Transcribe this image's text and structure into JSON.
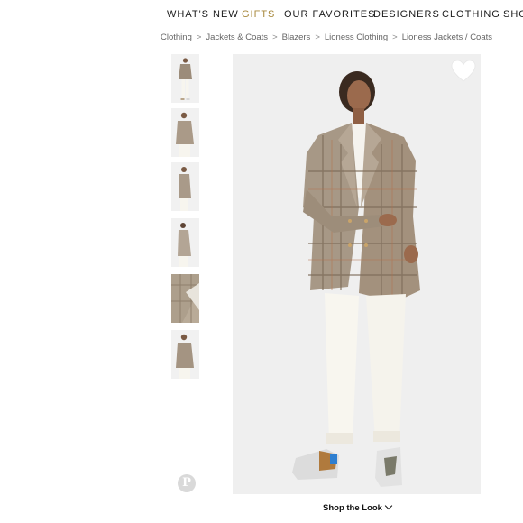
{
  "nav": {
    "items": [
      {
        "label": "WHAT'S NEW",
        "accent": false
      },
      {
        "label": "GIFTS",
        "accent": true
      },
      {
        "label": "OUR FAVORITES",
        "accent": false
      },
      {
        "label": "DESIGNERS",
        "accent": false
      },
      {
        "label": "CLOTHING",
        "accent": false
      },
      {
        "label": "SHO",
        "accent": false
      }
    ],
    "accent_color": "#a8893d"
  },
  "breadcrumb": {
    "items": [
      "Clothing",
      "Jackets & Coats",
      "Blazers",
      "Lioness Clothing",
      "Lioness Jackets / Coats"
    ],
    "separator": ">"
  },
  "gallery": {
    "thumbnails": [
      "thumbnail-full-front",
      "thumbnail-front-closeup",
      "thumbnail-side",
      "thumbnail-back-side",
      "thumbnail-fabric-detail",
      "thumbnail-front-buttoned"
    ],
    "main_image": "model-wearing-plaid-blazer-white-jeans",
    "favorite_icon": "heart-icon",
    "share_icon": "pinterest-icon",
    "pin_glyph": "P"
  },
  "shop_the_look": {
    "label": "Shop the Look",
    "icon": "chevron-down-icon"
  }
}
